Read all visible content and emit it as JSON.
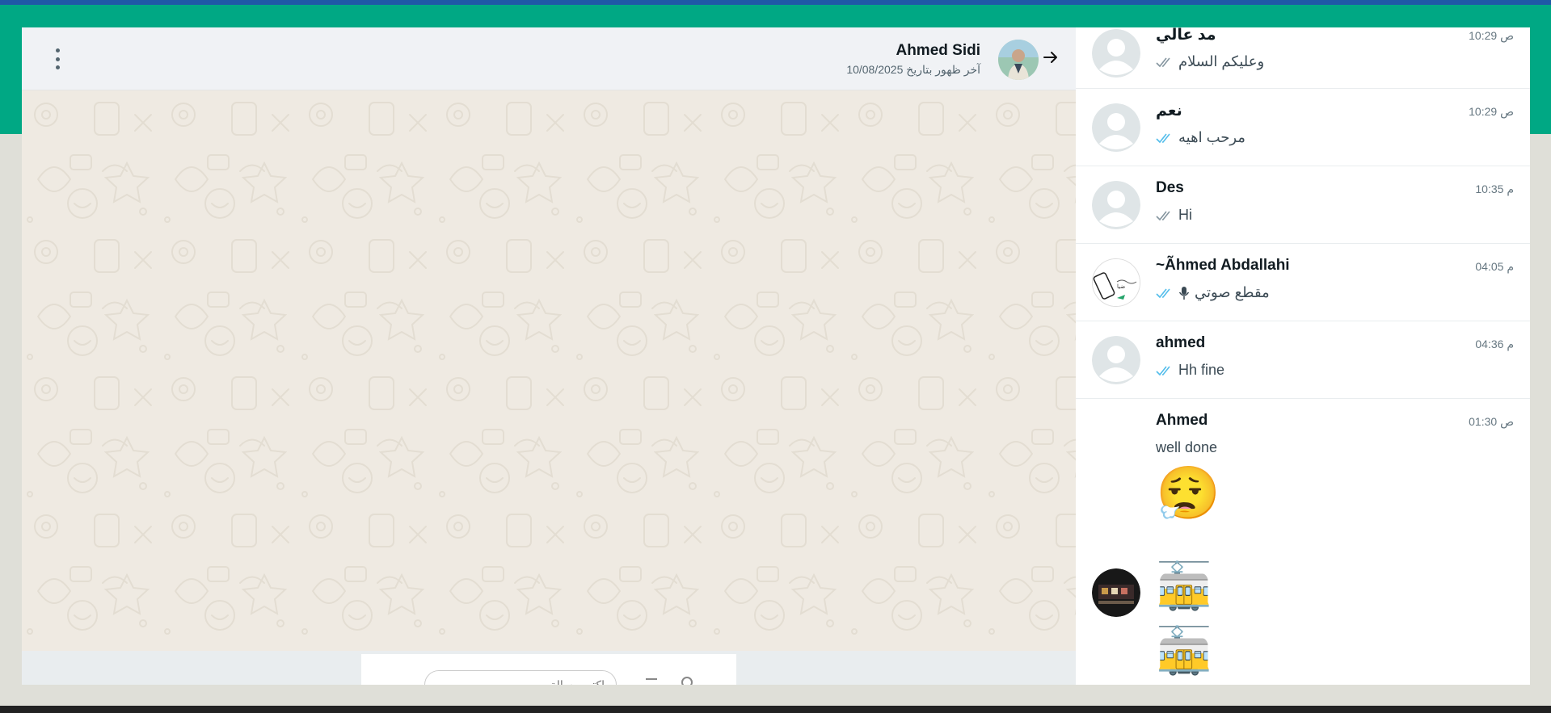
{
  "colors": {
    "accent": "#00a884",
    "top_strip": "#1f58a6",
    "read_tick": "#53bdeb",
    "sent_tick": "#8696a0"
  },
  "chat_header": {
    "contact_name": "Ahmed Sidi",
    "last_seen": "آخر ظهور بتاريخ 10/08/2025"
  },
  "composer": {
    "placeholder": "اكتب رسالة"
  },
  "chat_list": [
    {
      "name": "مد عالي",
      "time": "10:29 ص",
      "message": "وعليكم السلام",
      "tick": "sent",
      "avatar": "default"
    },
    {
      "name": "نعم",
      "time": "10:29 ص",
      "message": "مرحب اهيه",
      "tick": "read",
      "avatar": "default"
    },
    {
      "name": "Des",
      "time": "10:35 م",
      "message": "Hi",
      "tick": "sent",
      "avatar": "default"
    },
    {
      "name": "~Ãhmed Abdallahi",
      "time": "04:05 م",
      "message": "مقطع صوتي",
      "tick": "read",
      "avatar": "custom",
      "icon": "mic-icon"
    },
    {
      "name": "ahmed",
      "time": "04:36 م",
      "message": "Hh fine",
      "tick": "read",
      "avatar": "default"
    },
    {
      "name": "Ahmed",
      "time": "01:30 ص",
      "message": "well done",
      "emoji": "😮‍💨",
      "avatar": "none"
    }
  ],
  "trams": [
    "🚋",
    "🚋",
    "🚋"
  ]
}
